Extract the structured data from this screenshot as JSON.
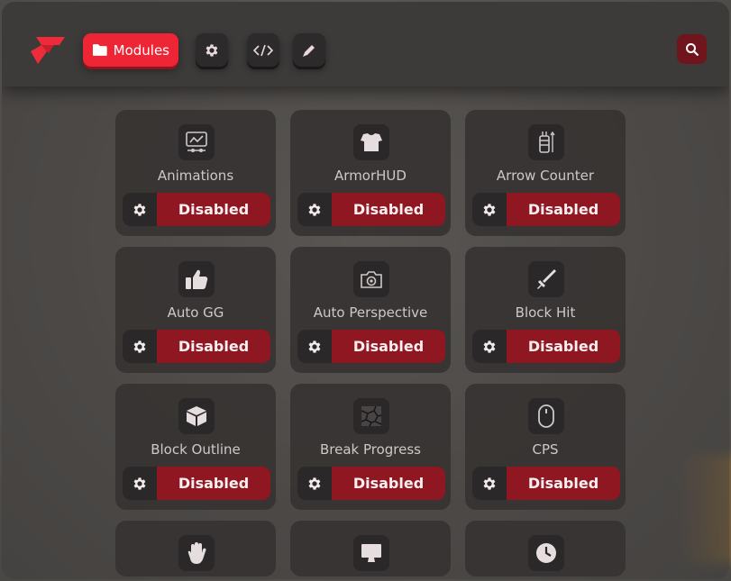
{
  "header": {
    "tabs": [
      {
        "name": "modules",
        "label": "Modules",
        "icon": "folder-icon",
        "active": true
      },
      {
        "name": "settings",
        "label": "",
        "icon": "gear-icon",
        "active": false
      },
      {
        "name": "scripts",
        "label": "",
        "icon": "code-icon",
        "active": false
      },
      {
        "name": "themes",
        "label": "",
        "icon": "pencil-icon",
        "active": false
      }
    ],
    "search_icon": "search-icon"
  },
  "colors": {
    "accent": "#ee2535",
    "disabled_button": "#8e1722",
    "card_bg": "#363332",
    "header_bg": "#3c3b3a"
  },
  "modules": [
    {
      "name": "Animations",
      "state": "Disabled",
      "icon": "animation-icon"
    },
    {
      "name": "ArmorHUD",
      "state": "Disabled",
      "icon": "chestplate-icon"
    },
    {
      "name": "Arrow Counter",
      "state": "Disabled",
      "icon": "quiver-icon"
    },
    {
      "name": "Auto GG",
      "state": "Disabled",
      "icon": "thumbs-up-icon"
    },
    {
      "name": "Auto Perspective",
      "state": "Disabled",
      "icon": "camera-icon"
    },
    {
      "name": "Block Hit",
      "state": "Disabled",
      "icon": "sword-icon"
    },
    {
      "name": "Block Outline",
      "state": "Disabled",
      "icon": "cube-icon"
    },
    {
      "name": "Break Progress",
      "state": "Disabled",
      "icon": "cracked-block-icon"
    },
    {
      "name": "CPS",
      "state": "Disabled",
      "icon": "mouse-icon"
    },
    {
      "name": "",
      "state": "",
      "icon": "hand-icon"
    },
    {
      "name": "",
      "state": "",
      "icon": "monitor-icon"
    },
    {
      "name": "",
      "state": "",
      "icon": "clock-icon"
    }
  ]
}
